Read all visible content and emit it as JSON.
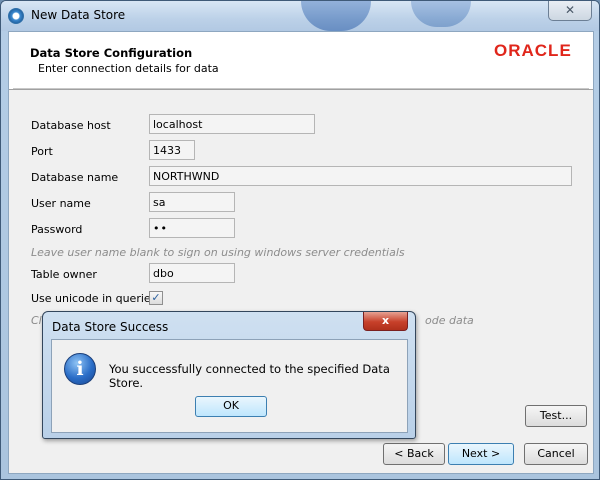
{
  "window": {
    "title": "New Data Store",
    "close_glyph": "✕"
  },
  "header": {
    "title": "Data Store Configuration",
    "subtitle": "Enter connection details for data",
    "logo_text": "ORACLE",
    "logo_color": "#e0261b"
  },
  "form": {
    "host_label": "Database host",
    "host_value": "localhost",
    "port_label": "Port",
    "port_value": "1433",
    "dbname_label": "Database name",
    "dbname_value": "NORTHWND",
    "user_label": "User name",
    "user_value": "sa",
    "password_label": "Password",
    "password_value": "••",
    "hint_credentials": "Leave user name blank to sign on using windows server credentials",
    "owner_label": "Table owner",
    "owner_value": "dbo",
    "unicode_label": "Use unicode in queries",
    "unicode_checked": true,
    "unicode_check_glyph": "✓",
    "hint_unicode_left": "Cl",
    "hint_unicode_right": "ode data"
  },
  "buttons": {
    "test": "Test...",
    "back": "< Back",
    "next": "Next >",
    "cancel": "Cancel"
  },
  "modal": {
    "title": "Data Store Success",
    "close_glyph": "x",
    "icon_glyph": "i",
    "message": "You successfully connected to the specified Data Store.",
    "ok": "OK"
  }
}
